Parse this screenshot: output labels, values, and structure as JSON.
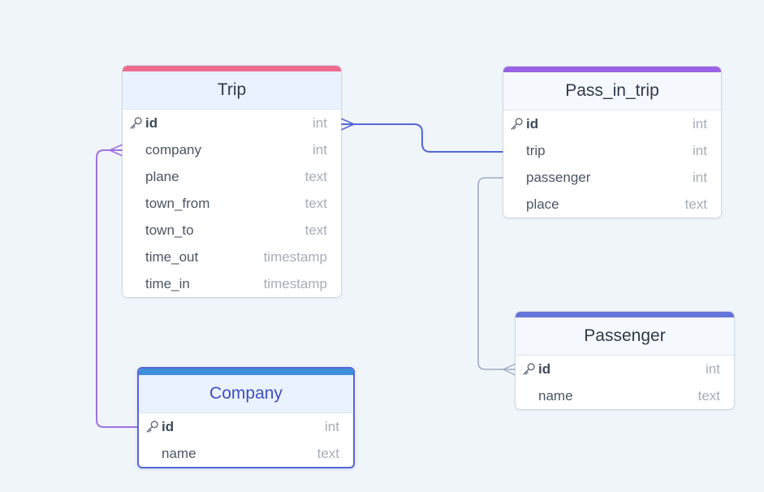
{
  "colors": {
    "background": "#f0f5f9",
    "trip_accent": "#ee6b8d",
    "pass_in_trip_accent": "#9a62e4",
    "passenger_accent": "#6574d8",
    "company_accent": "#3f8edb",
    "link_trip": "#5566d8",
    "link_company": "#a072e0",
    "link_passenger": "#a0acc4"
  },
  "tables": {
    "trip": {
      "name": "Trip",
      "fields": [
        {
          "name": "id",
          "type": "int",
          "pk": true
        },
        {
          "name": "company",
          "type": "int"
        },
        {
          "name": "plane",
          "type": "text"
        },
        {
          "name": "town_from",
          "type": "text"
        },
        {
          "name": "town_to",
          "type": "text"
        },
        {
          "name": "time_out",
          "type": "timestamp"
        },
        {
          "name": "time_in",
          "type": "timestamp"
        }
      ]
    },
    "pass_in_trip": {
      "name": "Pass_in_trip",
      "fields": [
        {
          "name": "id",
          "type": "int",
          "pk": true
        },
        {
          "name": "trip",
          "type": "int"
        },
        {
          "name": "passenger",
          "type": "int"
        },
        {
          "name": "place",
          "type": "text"
        }
      ]
    },
    "passenger": {
      "name": "Passenger",
      "fields": [
        {
          "name": "id",
          "type": "int",
          "pk": true
        },
        {
          "name": "name",
          "type": "text"
        }
      ]
    },
    "company": {
      "name": "Company",
      "fields": [
        {
          "name": "id",
          "type": "int",
          "pk": true
        },
        {
          "name": "name",
          "type": "text"
        }
      ]
    }
  }
}
